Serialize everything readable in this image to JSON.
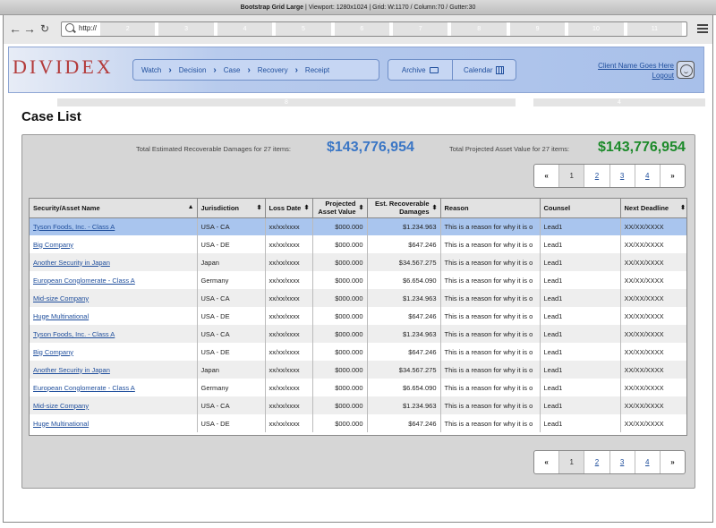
{
  "devbar": {
    "title": "Bootstrap Grid Large",
    "info": "Viewport: 1280x1024  |  Grid: W:1170 / Column:70 / Gutter:30"
  },
  "browser": {
    "url": "http://",
    "grid_columns": [
      "2",
      "3",
      "4",
      "5",
      "6",
      "7",
      "8",
      "9",
      "10",
      "11"
    ]
  },
  "header": {
    "logo": "DIVIDEX",
    "breadcrumbs": [
      "Watch",
      "Decision",
      "Case",
      "Recovery",
      "Receipt"
    ],
    "tools": {
      "archive": "Archive",
      "calendar": "Calendar"
    },
    "client_name": "Client Name Goes Here",
    "logout": "Logout"
  },
  "grid_strip": {
    "left": "8",
    "right": "4"
  },
  "page_title": "Case List",
  "totals": {
    "damages_label": "Total Estimated Recoverable Damages for 27 items:",
    "damages_value": "$143,776,954",
    "asset_label": "Total Projected Asset Value for 27 items:",
    "asset_value": "$143,776,954"
  },
  "pagination": {
    "prev": "«",
    "pages": [
      "1",
      "2",
      "3",
      "4"
    ],
    "next": "»",
    "current": "1"
  },
  "table": {
    "columns": [
      "Security/Asset Name",
      "Jurisdiction",
      "Loss Date",
      "Projected Asset Value",
      "Est. Recoverable Damages",
      "Reason",
      "Counsel",
      "Next Deadline"
    ],
    "rows": [
      [
        "Tyson Foods, Inc. - Class A",
        "USA - CA",
        "xx/xx/xxxx",
        "$000.000",
        "$1.234.963",
        "This is a reason for why it is o",
        "Lead1",
        "XX/XX/XXXX"
      ],
      [
        "Big Company",
        "USA - DE",
        "xx/xx/xxxx",
        "$000.000",
        "$647.246",
        "This is a reason for why it is o",
        "Lead1",
        "XX/XX/XXXX"
      ],
      [
        "Another Security in Japan",
        "Japan",
        "xx/xx/xxxx",
        "$000.000",
        "$34.567.275",
        "This is a reason for why it is o",
        "Lead1",
        "XX/XX/XXXX"
      ],
      [
        "European Conglomerate - Class A",
        "Germany",
        "xx/xx/xxxx",
        "$000.000",
        "$6.654.090",
        "This is a reason for why it is o",
        "Lead1",
        "XX/XX/XXXX"
      ],
      [
        "Mid-size Company",
        "USA - CA",
        "xx/xx/xxxx",
        "$000.000",
        "$1.234.963",
        "This is a reason for why it is o",
        "Lead1",
        "XX/XX/XXXX"
      ],
      [
        "Huge Multinational",
        "USA - DE",
        "xx/xx/xxxx",
        "$000.000",
        "$647.246",
        "This is a reason for why it is o",
        "Lead1",
        "XX/XX/XXXX"
      ],
      [
        "Tyson Foods, Inc. - Class A",
        "USA - CA",
        "xx/xx/xxxx",
        "$000.000",
        "$1.234.963",
        "This is a reason for why it is o",
        "Lead1",
        "XX/XX/XXXX"
      ],
      [
        "Big Company",
        "USA - DE",
        "xx/xx/xxxx",
        "$000.000",
        "$647.246",
        "This is a reason for why it is o",
        "Lead1",
        "XX/XX/XXXX"
      ],
      [
        "Another Security in Japan",
        "Japan",
        "xx/xx/xxxx",
        "$000.000",
        "$34.567.275",
        "This is a reason for why it is o",
        "Lead1",
        "XX/XX/XXXX"
      ],
      [
        "European Conglomerate - Class A",
        "Germany",
        "xx/xx/xxxx",
        "$000.000",
        "$6.654.090",
        "This is a reason for why it is o",
        "Lead1",
        "XX/XX/XXXX"
      ],
      [
        "Mid-size Company",
        "USA - CA",
        "xx/xx/xxxx",
        "$000.000",
        "$1.234.963",
        "This is a reason for why it is o",
        "Lead1",
        "XX/XX/XXXX"
      ],
      [
        "Huge Multinational",
        "USA - DE",
        "xx/xx/xxxx",
        "$000.000",
        "$647.246",
        "This is a reason for why it is o",
        "Lead1",
        "XX/XX/XXXX"
      ]
    ]
  },
  "colors": {
    "link": "#1f4e9c",
    "total_blue": "#3a76c5",
    "total_green": "#1c8a2a",
    "selected_row": "#a9c5ee"
  },
  "icons": {
    "back": "arrow-left-icon",
    "forward": "arrow-right-icon",
    "reload": "reload-icon",
    "search": "search-icon",
    "menu": "hamburger-menu-icon",
    "archive": "folder-icon",
    "calendar": "calendar-icon",
    "avatar": "smiley-avatar-icon"
  }
}
